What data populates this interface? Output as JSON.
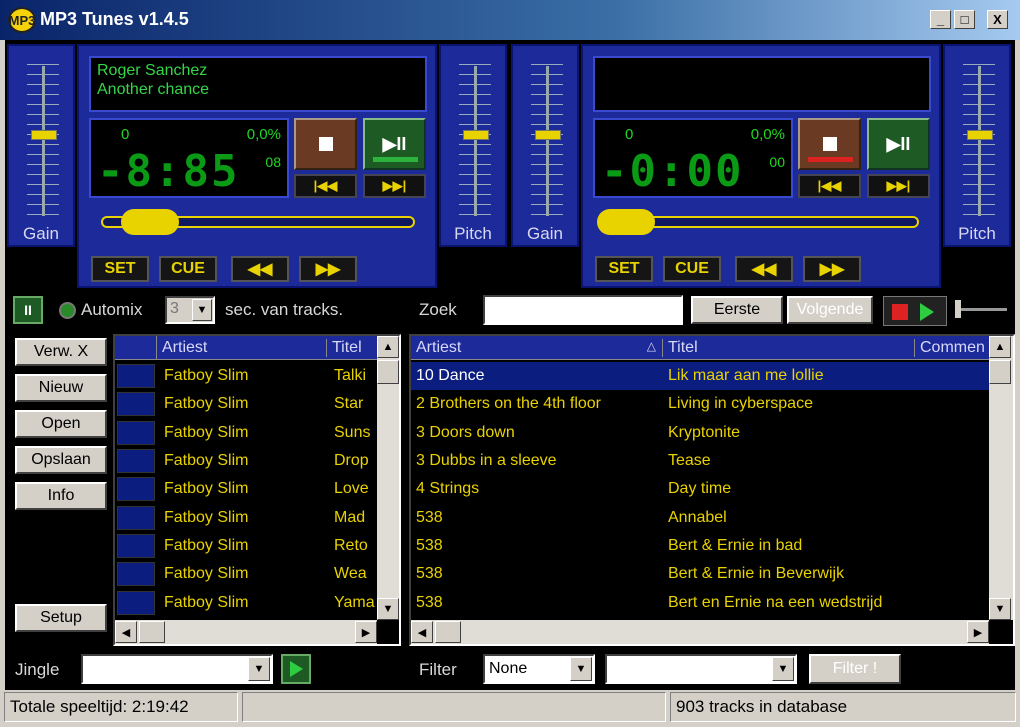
{
  "window": {
    "title": "MP3 Tunes v1.4.5",
    "logo_text": "MP3",
    "min": "_",
    "max": "□",
    "close": "X"
  },
  "decks": [
    {
      "artist": "Roger Sanchez",
      "song": "Another chance",
      "counter": "0",
      "percent": "0,0%",
      "time": "-8:85",
      "frames": "08",
      "gain_label": "Gain",
      "pitch_label": "Pitch",
      "set": "SET",
      "cue": "CUE",
      "rew": "◀◀",
      "ff": "▶▶",
      "prev": "|◀◀",
      "next": "▶▶|",
      "play": "▶II"
    },
    {
      "artist": "",
      "song": "",
      "counter": "0",
      "percent": "0,0%",
      "time": "-0:00",
      "frames": "00",
      "gain_label": "Gain",
      "pitch_label": "Pitch",
      "set": "SET",
      "cue": "CUE",
      "rew": "◀◀",
      "ff": "▶▶",
      "prev": "|◀◀",
      "next": "▶▶|",
      "play": "▶II"
    }
  ],
  "automix": {
    "pause": "II",
    "label": "Automix",
    "seconds": "3",
    "suffix": "sec. van tracks."
  },
  "search": {
    "label": "Zoek",
    "value": "",
    "first": "Eerste",
    "next": "Volgende"
  },
  "side": {
    "remove": "Verw. X",
    "new": "Nieuw",
    "open": "Open",
    "save": "Opslaan",
    "info": "Info",
    "setup": "Setup"
  },
  "playlist": {
    "headers": [
      "Artiest",
      "Titel"
    ],
    "rows": [
      {
        "artist": "Fatboy Slim",
        "title": "Talki"
      },
      {
        "artist": "Fatboy Slim",
        "title": "Star"
      },
      {
        "artist": "Fatboy Slim",
        "title": "Suns"
      },
      {
        "artist": "Fatboy Slim",
        "title": "Drop"
      },
      {
        "artist": "Fatboy Slim",
        "title": "Love"
      },
      {
        "artist": "Fatboy Slim",
        "title": "Mad"
      },
      {
        "artist": "Fatboy Slim",
        "title": "Reto"
      },
      {
        "artist": "Fatboy Slim",
        "title": "Wea"
      },
      {
        "artist": "Fatboy Slim",
        "title": "Yama"
      }
    ]
  },
  "database": {
    "headers": [
      "Artiest",
      "Titel",
      "Commen"
    ],
    "rows": [
      {
        "artist": "10 Dance",
        "title": "Lik maar aan me lollie",
        "selected": true
      },
      {
        "artist": "2 Brothers on the 4th floor",
        "title": "Living in cyberspace"
      },
      {
        "artist": "3 Doors down",
        "title": "Kryptonite"
      },
      {
        "artist": "3 Dubbs in a sleeve",
        "title": "Tease"
      },
      {
        "artist": "4 Strings",
        "title": "Day time"
      },
      {
        "artist": "538",
        "title": "Annabel"
      },
      {
        "artist": "538",
        "title": "Bert & Ernie in bad"
      },
      {
        "artist": "538",
        "title": "Bert & Ernie in Beverwijk"
      },
      {
        "artist": "538",
        "title": "Bert en Ernie na een wedstrijd"
      }
    ]
  },
  "jingle": {
    "label": "Jingle",
    "value": ""
  },
  "filter": {
    "label": "Filter",
    "value": "None",
    "second": "",
    "button": "Filter !"
  },
  "status": {
    "total": "Totale speeltijd: 2:19:42",
    "tracks": "903 tracks in database"
  },
  "colors": {
    "deck_blue": "#1c2a9a",
    "lcd_green": "#34d648",
    "accent_yellow": "#e8d200"
  }
}
